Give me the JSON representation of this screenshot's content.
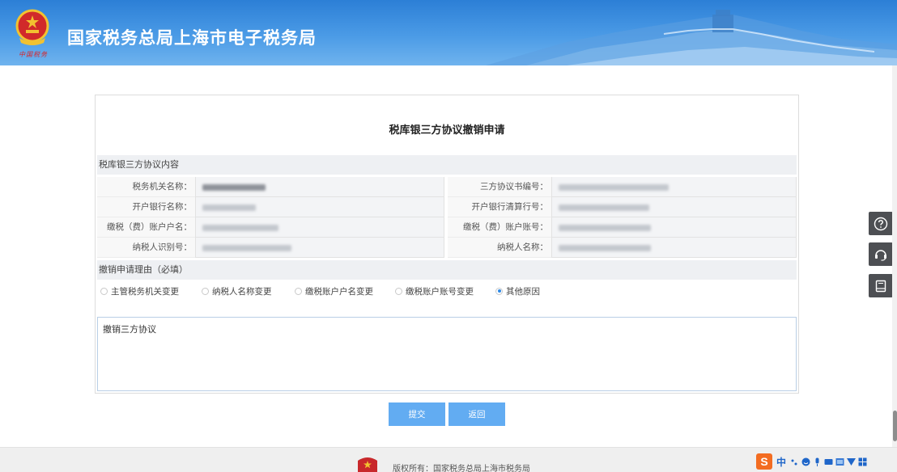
{
  "header": {
    "title": "国家税务总局上海市电子税务局",
    "logo_text": "中国税务"
  },
  "form": {
    "title": "税库银三方协议撤销申请",
    "section_agreement": "税库银三方协议内容",
    "rows": [
      {
        "left_label": "税务机关名称：",
        "right_label": "三方协议书编号："
      },
      {
        "left_label": "开户银行名称：",
        "right_label": "开户银行清算行号："
      },
      {
        "left_label": "缴税（费）账户户名：",
        "right_label": "缴税（费）账户账号："
      },
      {
        "left_label": "纳税人识别号：",
        "right_label": "纳税人名称："
      }
    ],
    "section_reason": "撤销申请理由（必填）",
    "reasons": [
      {
        "label": "主管税务机关变更",
        "selected": false
      },
      {
        "label": "纳税人名称变更",
        "selected": false
      },
      {
        "label": "缴税账户户名变更",
        "selected": false
      },
      {
        "label": "缴税账户账号变更",
        "selected": false
      },
      {
        "label": "其他原因",
        "selected": true
      }
    ],
    "reason_text": "撤销三方协议",
    "submit_label": "提交",
    "back_label": "返回"
  },
  "side_tools": [
    "help-icon",
    "service-icon",
    "manual-icon"
  ],
  "footer": {
    "copyright": "版权所有：国家税务总局上海市税务局"
  },
  "ime": {
    "logo": "S",
    "mode": "中"
  },
  "colors": {
    "header_blue": "#2c7fd6",
    "button_blue": "#62acf2",
    "radio_selected": "#2f8ae6",
    "side_tool_bg": "#4d4f53"
  }
}
